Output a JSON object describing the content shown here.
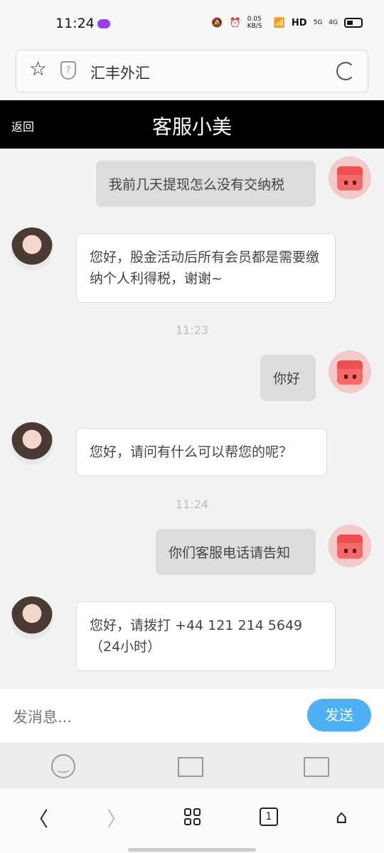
{
  "status": {
    "time": "11:24",
    "net_speed": "0.05 KB/S",
    "hd": "HD",
    "sig1": "5G",
    "sig2": "4G"
  },
  "browser": {
    "url_title": "汇丰外汇"
  },
  "header": {
    "back": "返回",
    "title": "客服小美"
  },
  "messages": [
    {
      "from": "me",
      "text": "我前几天提现怎么没有交纳税"
    },
    {
      "from": "them",
      "text": "您好，股金活动后所有会员都是需要缴纳个人利得税，谢谢~"
    },
    {
      "timestamp": "11:23"
    },
    {
      "from": "me",
      "text": "你好"
    },
    {
      "from": "them",
      "text": "您好，请问有什么可以帮您的呢？"
    },
    {
      "timestamp": "11:24"
    },
    {
      "from": "me",
      "text": "你们客服电话请告知"
    },
    {
      "from": "them",
      "text": "您好，请拨打 +44 121 214 5649（24小时）"
    }
  ],
  "input": {
    "placeholder": "发消息...",
    "send": "发送"
  },
  "nav": {
    "tab_count": "1",
    "back": "〈",
    "forward": "〉",
    "home": "⌂"
  }
}
